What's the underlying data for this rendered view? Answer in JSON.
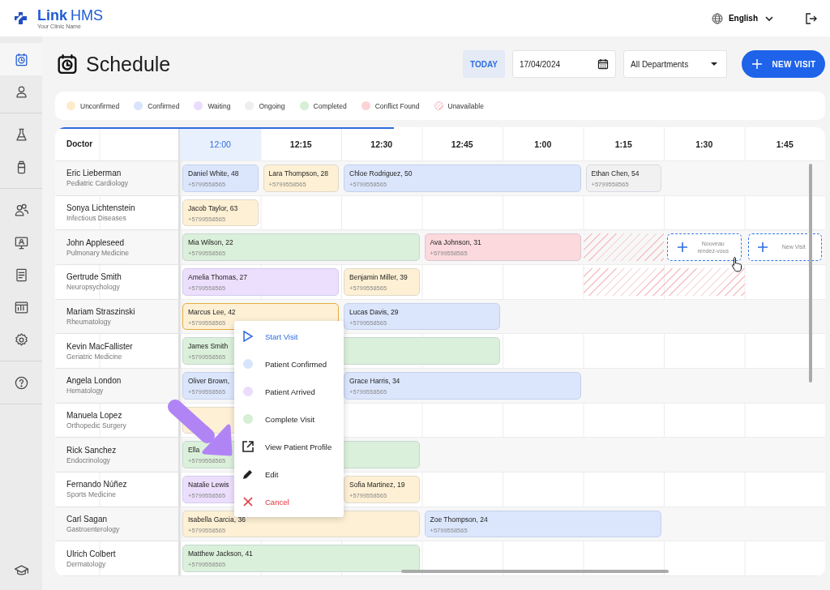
{
  "header": {
    "logo_bold": "Link",
    "logo_light": "HMS",
    "clinic": "Your Clinic Name",
    "language": "English"
  },
  "sidebar": {
    "groups": [
      {
        "items": [
          {
            "kind": "schedule",
            "selected": true
          },
          {
            "kind": "person",
            "selected": false
          }
        ]
      },
      {
        "items": [
          {
            "kind": "flask",
            "selected": false
          },
          {
            "kind": "bottle",
            "selected": false
          }
        ]
      },
      {
        "items": [
          {
            "kind": "people",
            "selected": false
          },
          {
            "kind": "monitor",
            "selected": false
          },
          {
            "kind": "document",
            "selected": false
          },
          {
            "kind": "chart",
            "selected": false
          },
          {
            "kind": "gear",
            "selected": false
          }
        ]
      },
      {
        "items": [
          {
            "kind": "help",
            "selected": false
          }
        ]
      }
    ],
    "bottom": [
      {
        "kind": "graduation",
        "selected": false
      }
    ]
  },
  "page": {
    "title": "Schedule",
    "today": "TODAY",
    "date": "17/04/2024",
    "department": "All Departments",
    "new_visit": "NEW VISIT"
  },
  "legend": [
    {
      "label": "Unconfirmed",
      "color": "#fdeccb",
      "kind": "dot"
    },
    {
      "label": "Confirmed",
      "color": "#d8e4fc",
      "kind": "dot"
    },
    {
      "label": "Waiting",
      "color": "#ebdcfc",
      "kind": "dot"
    },
    {
      "label": "Ongoing",
      "color": "#eeeeee",
      "kind": "dot"
    },
    {
      "label": "Completed",
      "color": "#d6efd5",
      "kind": "dot"
    },
    {
      "label": "Conflict Found",
      "color": "#fbd3d7",
      "kind": "dot"
    },
    {
      "label": "Unavailable",
      "color": "#f6c2c8",
      "kind": "hatched"
    }
  ],
  "schedule": {
    "progress": {
      "level": 0.44
    },
    "doctor_heading": "Doctor",
    "columns": [
      {
        "label": "12:00",
        "selected": true
      },
      {
        "label": "12:15",
        "selected": false
      },
      {
        "label": "12:30",
        "selected": false
      },
      {
        "label": "12:45",
        "selected": false
      },
      {
        "label": "1:00",
        "selected": false
      },
      {
        "label": "1:15",
        "selected": false
      },
      {
        "label": "1:30",
        "selected": false
      },
      {
        "label": "1:45",
        "selected": false
      }
    ],
    "rows": [
      {
        "doctor": "Eric Lieberman",
        "department": "Pediatric Cardiology",
        "slots": [
          {
            "kind": "appointment",
            "patient": "Daniel White, 48",
            "phone": "+5799558565",
            "color": "#dbe6fd",
            "selected": false
          },
          {
            "kind": "appointment",
            "patient": "Lara Thompson, 28",
            "phone": "+5799558565",
            "color": "#fdf0d4",
            "selected": false
          },
          {
            "kind": "appointment",
            "patient": "Chloe Rodriguez, 50",
            "phone": "+5799558565",
            "color": "#dbe6fd",
            "selected": false
          },
          {
            "kind": "continued"
          },
          {
            "kind": "continued"
          },
          {
            "kind": "appointment",
            "patient": "Ethan Chen, 54",
            "phone": "+5799558565",
            "color": "#f1f1f1",
            "selected": false
          }
        ]
      },
      {
        "doctor": "Sonya Lichtenstein",
        "department": "Infectious Diseases",
        "slots": [
          {
            "kind": "appointment",
            "patient": "Jacob Taylor, 63",
            "phone": "+5799558565",
            "color": "#fdf0d4",
            "selected": false
          }
        ]
      },
      {
        "doctor": "John Appleseed",
        "department": "Pulmonary Medicine",
        "slots": [
          {
            "kind": "appointment",
            "patient": "Mia Wilson, 22",
            "phone": "+5799558565",
            "color": "#dbf0da",
            "selected": false
          },
          {
            "kind": "continued"
          },
          {
            "kind": "continued"
          },
          {
            "kind": "appointment",
            "patient": "Ava Johnson, 31",
            "phone": "+5799558565",
            "color": "#fbd9dc",
            "selected": false
          },
          {
            "kind": "continued"
          },
          {
            "kind": "unavailable"
          },
          {
            "kind": "new_visit",
            "label": "Nouveau rendez-vous"
          },
          {
            "kind": "new_visit",
            "label": "New Visit"
          }
        ]
      },
      {
        "doctor": "Gertrude Smith",
        "department": "Neuropsychology",
        "slots": [
          {
            "kind": "appointment",
            "patient": "Amelia Thomas, 27",
            "phone": "+5799558565",
            "color": "#ecdffd",
            "selected": false
          },
          {
            "kind": "continued"
          },
          {
            "kind": "appointment",
            "patient": "Benjamin Miller, 39",
            "phone": "+5799558565",
            "color": "#fdf0d4",
            "selected": false
          },
          {
            "kind": "empty"
          },
          {
            "kind": "empty"
          },
          {
            "kind": "unavailable"
          },
          {
            "kind": "continued"
          }
        ]
      },
      {
        "doctor": "Mariam Straszinski",
        "department": "Rheumatology",
        "slots": [
          {
            "kind": "appointment",
            "patient": "Marcus Lee, 42",
            "phone": "+5799558565",
            "color": "#fdf0d4",
            "selected": true
          },
          {
            "kind": "continued"
          },
          {
            "kind": "appointment",
            "patient": "Lucas Davis, 29",
            "phone": "+5799558565",
            "color": "#dbe6fd",
            "selected": false
          },
          {
            "kind": "continued"
          }
        ]
      },
      {
        "doctor": "Kevin MacFallister",
        "department": "Geriatric Medicine",
        "slots": [
          {
            "kind": "appointment",
            "patient": "James Smith",
            "phone": "+5799558565",
            "color": "#dbf0da",
            "selected": false
          },
          {
            "kind": "continued"
          },
          {
            "kind": "continued"
          },
          {
            "kind": "continued"
          }
        ]
      },
      {
        "doctor": "Angela London",
        "department": "Hematology",
        "slots": [
          {
            "kind": "appointment",
            "patient": "Oliver Brown,",
            "phone": "+5799558565",
            "color": "#dbe6fd",
            "selected": false
          },
          {
            "kind": "continued"
          },
          {
            "kind": "appointment",
            "patient": "Grace Harris, 34",
            "phone": "+5799558565",
            "color": "#dbe6fd",
            "selected": false
          },
          {
            "kind": "continued"
          },
          {
            "kind": "continued"
          }
        ]
      },
      {
        "doctor": "Manuela Lopez",
        "department": "Orthopedic Surgery",
        "slots": [
          {
            "kind": "appointment",
            "color": "#fdf0d4",
            "selected": false
          }
        ]
      },
      {
        "doctor": "Rick Sanchez",
        "department": "Endocrinology",
        "slots": [
          {
            "kind": "appointment",
            "patient": "Ella",
            "phone": "+5799558565",
            "color": "#dbf0da",
            "selected": false
          },
          {
            "kind": "continued"
          },
          {
            "kind": "continued"
          }
        ]
      },
      {
        "doctor": "Fernando Núñez",
        "department": "Sports Medicine",
        "slots": [
          {
            "kind": "appointment",
            "patient": "Natalie Lewis",
            "phone": "+5799558565",
            "color": "#ecdffd",
            "selected": false
          },
          {
            "kind": "continued"
          },
          {
            "kind": "appointment",
            "patient": "Sofia Martinez, 19",
            "phone": "+5799558565",
            "color": "#fdf0d4",
            "selected": false
          }
        ]
      },
      {
        "doctor": "Carl Sagan",
        "department": "Gastroenterology",
        "slots": [
          {
            "kind": "appointment",
            "patient": "Isabella Garcia, 36",
            "phone": "+5799558565",
            "color": "#fdf0d4",
            "selected": false
          },
          {
            "kind": "continued"
          },
          {
            "kind": "continued"
          },
          {
            "kind": "appointment",
            "patient": "Zoe Thompson, 24",
            "phone": "+5799558565",
            "color": "#dbe6fd",
            "selected": false
          },
          {
            "kind": "continued"
          },
          {
            "kind": "continued"
          }
        ]
      },
      {
        "doctor": "Ulrich Colbert",
        "department": "Dermatology",
        "slots": [
          {
            "kind": "appointment",
            "patient": "Matthew Jackson, 41",
            "phone": "+5799558565",
            "color": "#dbf0da",
            "selected": false
          },
          {
            "kind": "continued"
          },
          {
            "kind": "continued"
          }
        ]
      }
    ]
  },
  "context_menu": [
    {
      "kind": "start",
      "label": "Start Visit"
    },
    {
      "kind": "status",
      "label": "Patient Confirmed",
      "color": "#d8e4fc"
    },
    {
      "kind": "status",
      "label": "Patient Arrived",
      "color": "#ebdcfc"
    },
    {
      "kind": "status",
      "label": "Complete Visit",
      "color": "#d6efd5"
    },
    {
      "kind": "profile",
      "label": "View Patient Profile"
    },
    {
      "kind": "edit",
      "label": "Edit"
    },
    {
      "kind": "cancel",
      "label": "Cancel"
    }
  ]
}
